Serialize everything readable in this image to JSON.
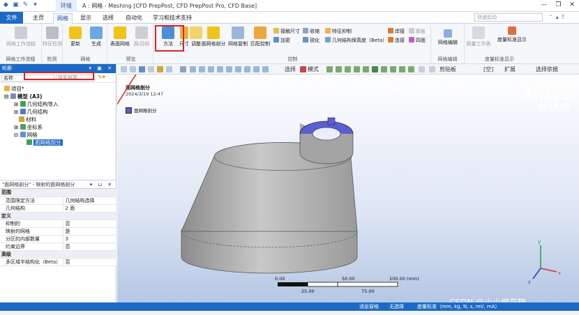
{
  "title": {
    "context_tab": "环境",
    "window_title": "A : 网格 - Meshing [CFD PrepPost, CFD PrepPost Pro, CFD Base]"
  },
  "tabs": [
    "文件",
    "主页",
    "网格",
    "显示",
    "选择",
    "自动化",
    "学习和技术支持"
  ],
  "quick_search_placeholder": "快速启动",
  "ribbon": {
    "groups": [
      "网格工作流程",
      "检测",
      "网格",
      "预览",
      "控制",
      "网格编辑",
      "度量标准显示"
    ],
    "buttons": {
      "workflow": "网格工作流程",
      "feature_detect": "特征检测",
      "update": "更新",
      "generate": "生成",
      "surface_mesh": "表面网格",
      "source_target": "源/目标",
      "method": "方法",
      "size": "尺寸",
      "adjust": "调整",
      "face_mesh": "面网格剖分",
      "mesh_copy": "网格复制",
      "match_control": "匹配控制",
      "contact_size": "接触尺寸",
      "shrink": "收缩",
      "feature_suppress": "特征抑制",
      "weld": "焊接",
      "refine": "加密",
      "pinch": "膨胀",
      "multi_geom": "几何结构保真度（Beta）",
      "connect": "连接",
      "quadrilateral": "四面",
      "sharpen": "锐化",
      "mesh_edit": "网格编辑",
      "quality_workspace": "质量工作表",
      "metric_display": "度量标准显示"
    }
  },
  "outline": {
    "header": "轮廓",
    "filter_name": "名称",
    "filter_search": "搜索概要",
    "nodes": {
      "project": "项目*",
      "model": "模型 (A3)",
      "geom_import": "几何结构导入",
      "geom": "几何结构",
      "materials": "材料",
      "coord": "坐标系",
      "mesh": "网格",
      "face_mesh": "面网格剖分"
    }
  },
  "details": {
    "header": "\"面网格剖分\" - 映射的面网格剖分",
    "sections": [
      {
        "name": "范围",
        "rows": [
          [
            "范围限定方法",
            "几何结构选择"
          ],
          [
            "几何结构",
            "2 面"
          ]
        ]
      },
      {
        "name": "定义",
        "rows": [
          [
            "抑制的",
            "否"
          ],
          [
            "映射的网格",
            "是"
          ],
          [
            "分区的内部数量",
            "3"
          ],
          [
            "约束边界",
            "否"
          ]
        ]
      },
      {
        "name": "高级",
        "rows": [
          [
            "多区域半结构化（Beta）",
            "否"
          ]
        ]
      }
    ]
  },
  "view_toolbar": {
    "select_label": "选择",
    "mode_label": "模式",
    "clipboard": "剪贴板",
    "empty": "[空]",
    "expand": "扩展",
    "select_by": "选择依据"
  },
  "viewport": {
    "title": "面网格剖分",
    "date": "2024/3/19 12:47",
    "legend": "面网格剖分",
    "logo": "Ansys",
    "version": "2024 R1",
    "scale_labels": [
      "0.00",
      "50.00",
      "100.00 (mm)",
      "25.00",
      "75.00"
    ]
  },
  "statusbar": {
    "messages": "消息窗格",
    "selection": "无选择",
    "units": "度量标准（mm, kg, N, s, mV, mA）"
  },
  "watermark": "CSDN @小小棉花糖",
  "colors": {
    "accent": "#1d6ac6",
    "highlight": "#e02020",
    "mesh_face": "#5b5fd6",
    "body": "#b4b4b4"
  }
}
